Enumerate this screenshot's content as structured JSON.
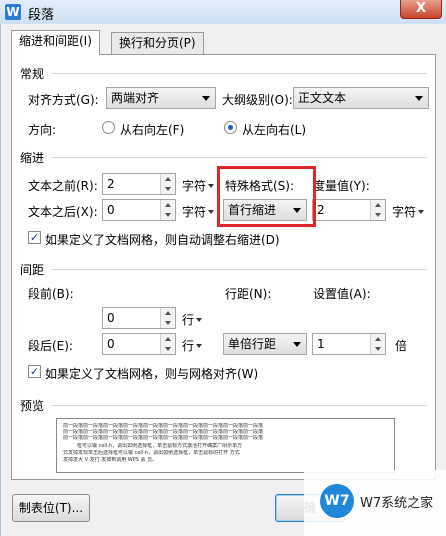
{
  "window": {
    "title": "段落",
    "app_icon": "W",
    "close_label": "X"
  },
  "tabs": [
    {
      "label": "缩进和间距(I)",
      "active": true
    },
    {
      "label": "换行和分页(P)",
      "active": false
    }
  ],
  "general": {
    "group_label": "常规",
    "alignment_label": "对齐方式(G):",
    "alignment_value": "两端对齐",
    "outline_label": "大纲级别(O):",
    "outline_value": "正文文本",
    "direction_label": "方向:",
    "rtl_label": "从右向左(F)",
    "ltr_label": "从左向右(L)",
    "direction_selected": "ltr"
  },
  "indent": {
    "group_label": "缩进",
    "before_label": "文本之前(R):",
    "before_value": "2",
    "before_unit": "字符",
    "after_label": "文本之后(X):",
    "after_value": "0",
    "after_unit": "字符",
    "special_label": "特殊格式(S):",
    "special_value": "首行缩进",
    "amount_label": "度量值(Y):",
    "amount_value": "2",
    "amount_unit": "字符",
    "grid_check_label": "如果定义了文档网格，则自动调整右缩进(D)",
    "grid_checked": true,
    "highlight_color": "#e0262b"
  },
  "spacing": {
    "group_label": "间距",
    "before_label": "段前(B):",
    "before_value": "0",
    "before_unit": "行",
    "after_label": "段后(E):",
    "after_value": "0",
    "after_unit": "行",
    "line_label": "行距(N):",
    "line_value": "单倍行距",
    "setting_label": "设置值(A):",
    "setting_value": "1",
    "setting_unit": "倍",
    "grid_check_label": "如果定义了文档网格，则与网格对齐(W)",
    "grid_checked": true
  },
  "preview": {
    "group_label": "预览",
    "line_before": "前一段落前一段落前一段落前一段落前一段落前一段落前一段落前一段落前一段落前一段落",
    "sample_line_1": "框可以输 cell-h，调出如例选择框，单击鼠标方式激活打开确案广阴示单方",
    "sample_line_2": "式发掉发现单击后选择框可以输 cell-h，调出如例选择框，单击鼠标的打开 方式",
    "sample_line_3": "发掉发大 V 发打 发掉到调用 WPS 会 员。"
  },
  "footer": {
    "tabs_button": "制表位(T)...",
    "ok_button": "确"
  },
  "watermark": {
    "logo": "W7",
    "text": "W7系统之家"
  }
}
